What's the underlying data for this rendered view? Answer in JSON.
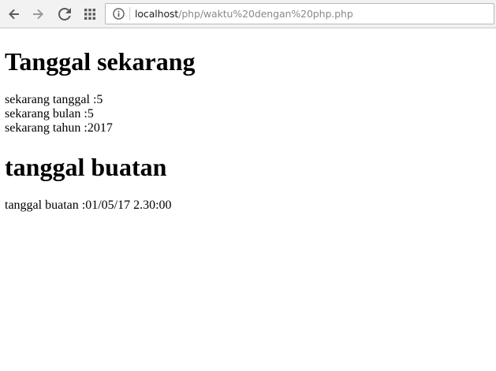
{
  "browser": {
    "address_host": "localhost",
    "address_path": "/php/waktu%20dengan%20php.php",
    "icons": {
      "back": "arrow-left-icon",
      "forward": "arrow-right-icon",
      "reload": "reload-icon",
      "apps": "apps-grid-icon",
      "site_info": "info-icon"
    }
  },
  "page": {
    "heading_now": "Tanggal sekarang",
    "date_lines": [
      {
        "label": "sekarang tanggal :",
        "value": "5"
      },
      {
        "label": "sekarang bulan :",
        "value": "5"
      },
      {
        "label": "sekarang tahun :",
        "value": "2017"
      }
    ],
    "heading_made": "tanggal buatan",
    "made_line": {
      "label": "tanggal buatan :",
      "value": "01/05/17 2.30:00"
    }
  },
  "colors": {
    "toolbar_bg": "#f2f2f2",
    "url_host": "#202020",
    "url_path": "#8a8a8a",
    "icon": "#5a5a5a"
  }
}
